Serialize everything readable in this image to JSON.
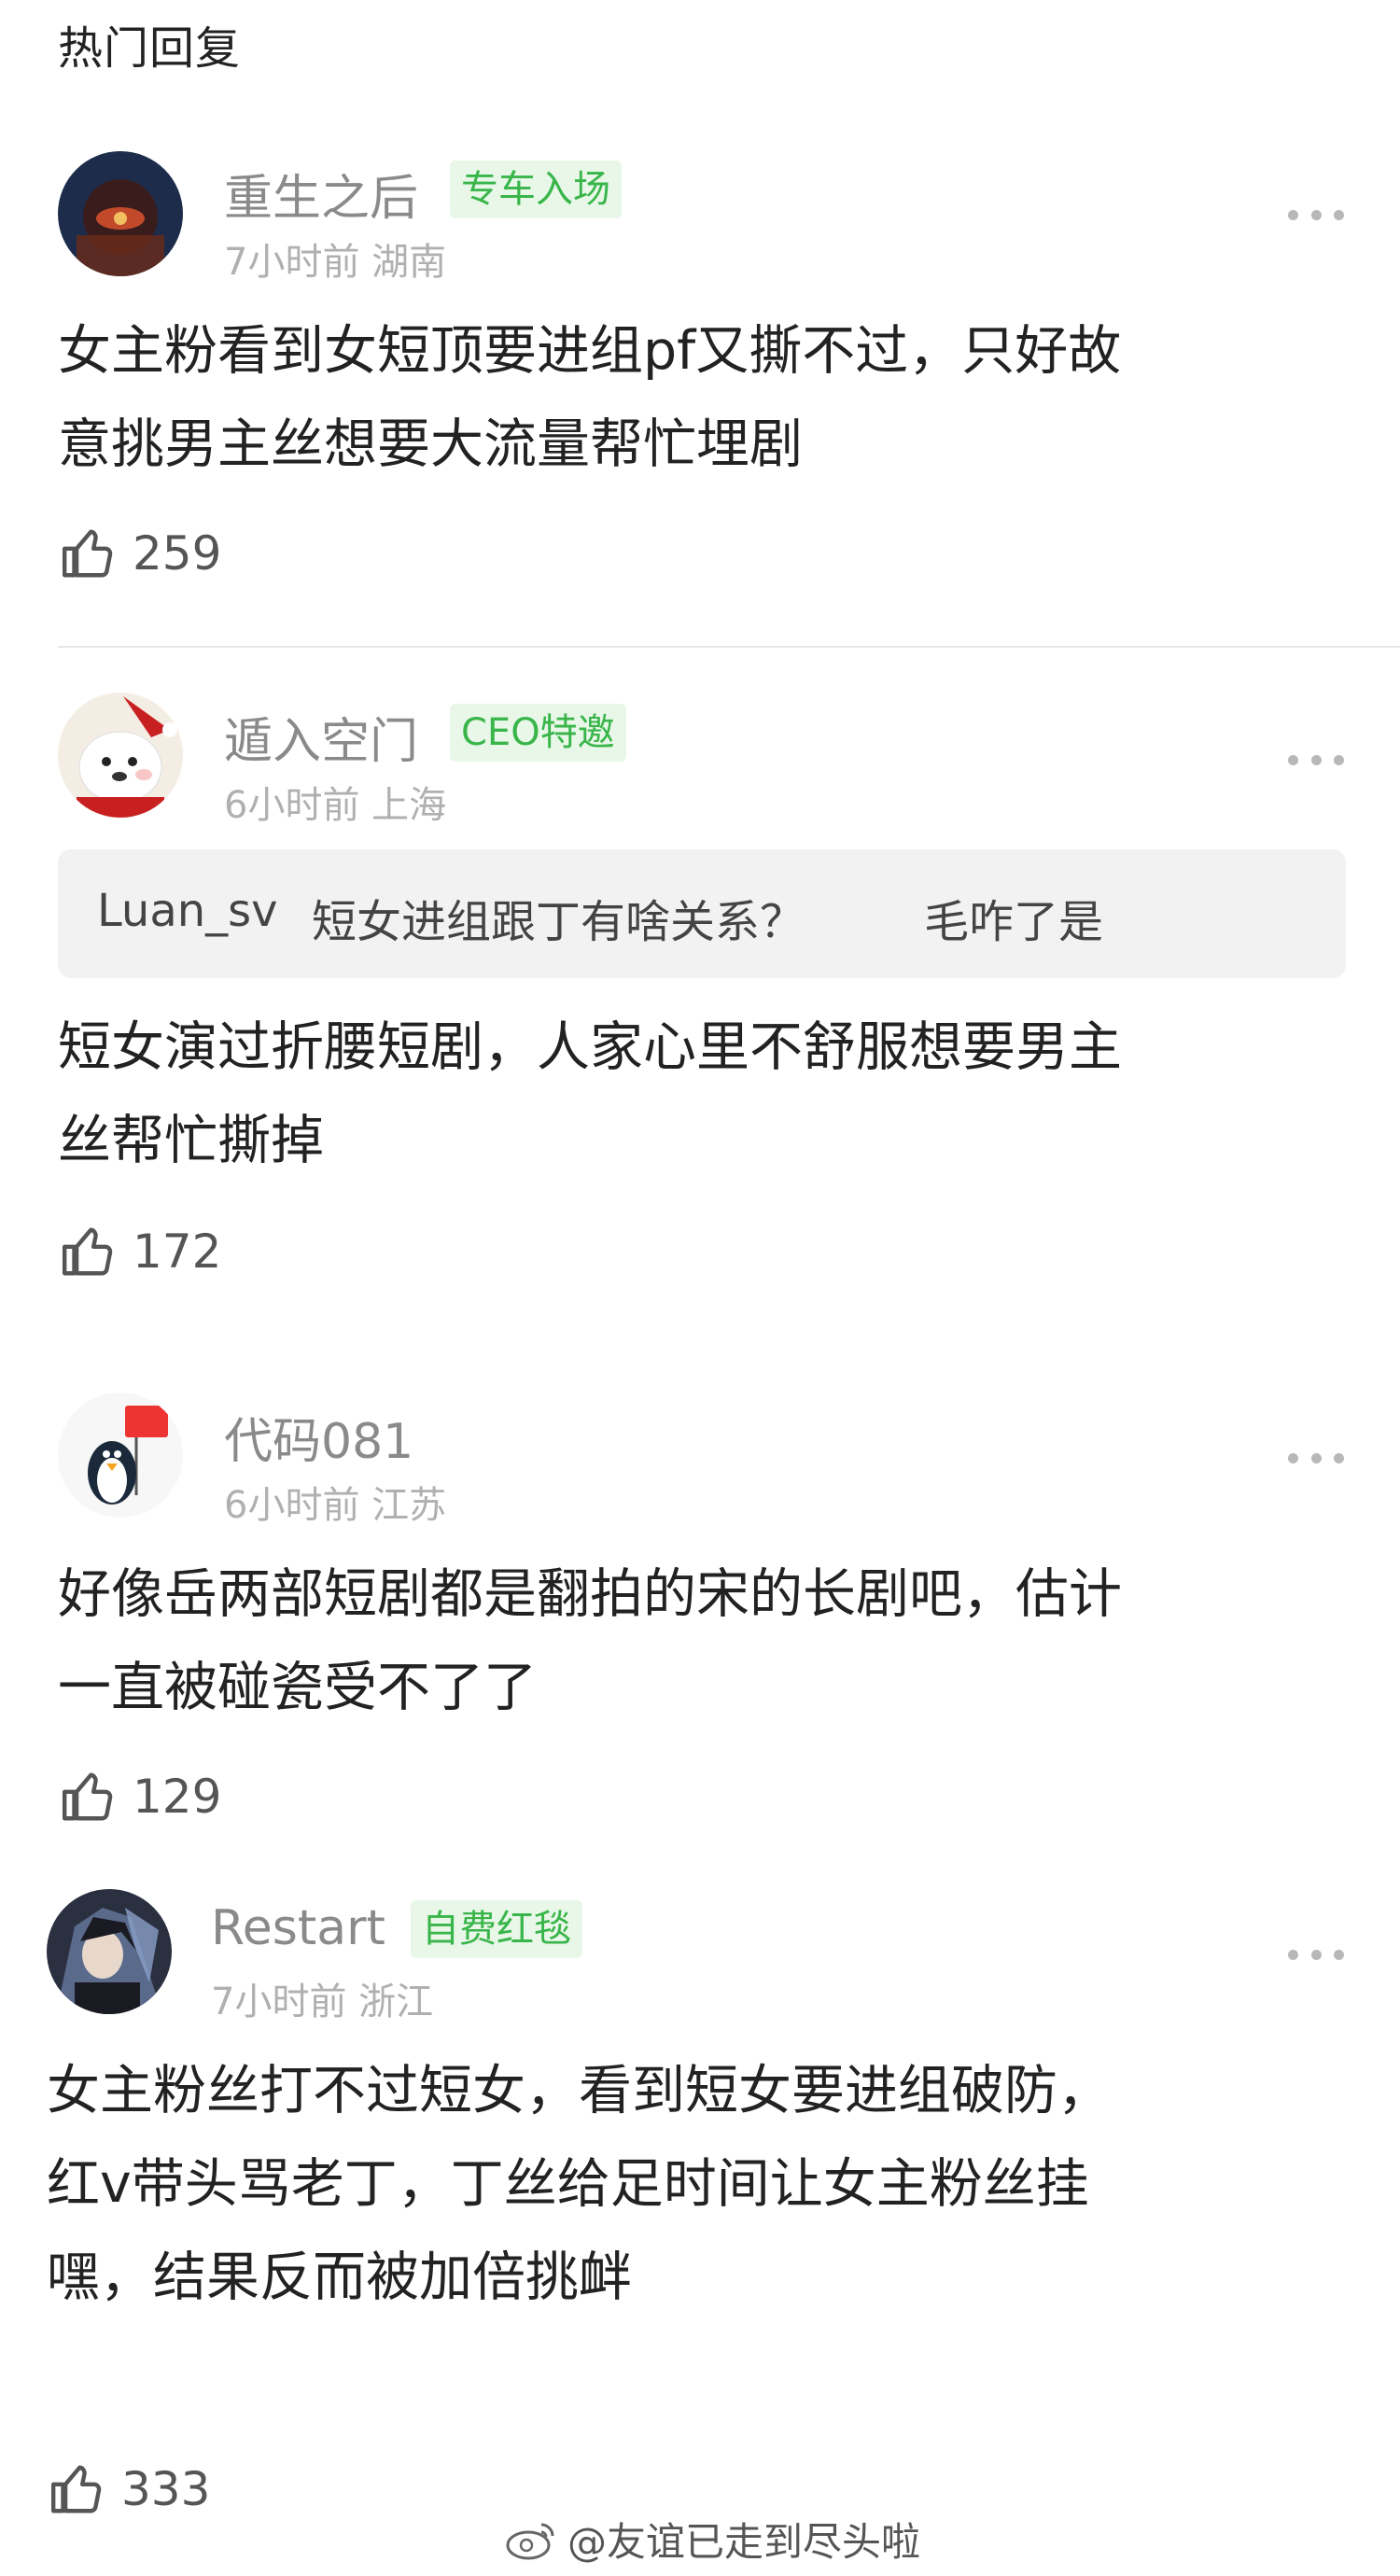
{
  "section_title": "热门回复",
  "comments": [
    {
      "name": "重生之后",
      "badge": "专车入场",
      "time": "7小时前",
      "location": "湖南",
      "text_line1": "女主粉看到女短顶要进组pf又撕不过，只好故",
      "text_line2": "意挑男主丝想要大流量帮忙埋剧",
      "likes": "259"
    },
    {
      "name": "遁入空门",
      "badge": "CEO特邀",
      "time": "6小时前",
      "location": "上海",
      "quote_user": "Luan_sv",
      "quote_text": "短女进组跟丁有啥关系？",
      "quote_reply": "毛咋了是",
      "text_line1": "短女演过折腰短剧，人家心里不舒服想要男主",
      "text_line2": "丝帮忙撕掉",
      "likes": "172"
    },
    {
      "name": "代码081",
      "time": "6小时前",
      "location": "江苏",
      "text_line1": "好像岳两部短剧都是翻拍的宋的长剧吧，估计",
      "text_line2": "一直被碰瓷受不了了",
      "likes": "129"
    },
    {
      "name": "Restart",
      "badge": "自费红毯",
      "time": "7小时前",
      "location": "浙江",
      "text_line1": "女主粉丝打不过短女，看到短女要进组破防，",
      "text_line2": "红v带头骂老丁，丁丝给足时间让女主粉丝挂",
      "text_line3": "嘿，结果反而被加倍挑衅",
      "likes": "333"
    }
  ],
  "watermark": "@友谊已走到尽头啦",
  "colors": {
    "badge_bg": "#e8f7e8",
    "badge_text": "#39b54a",
    "name_gray": "#8a8a8a",
    "meta_gray": "#b0b0b0"
  },
  "icons": [
    "more-icon",
    "thumbs-up-icon",
    "weibo-logo-icon"
  ]
}
